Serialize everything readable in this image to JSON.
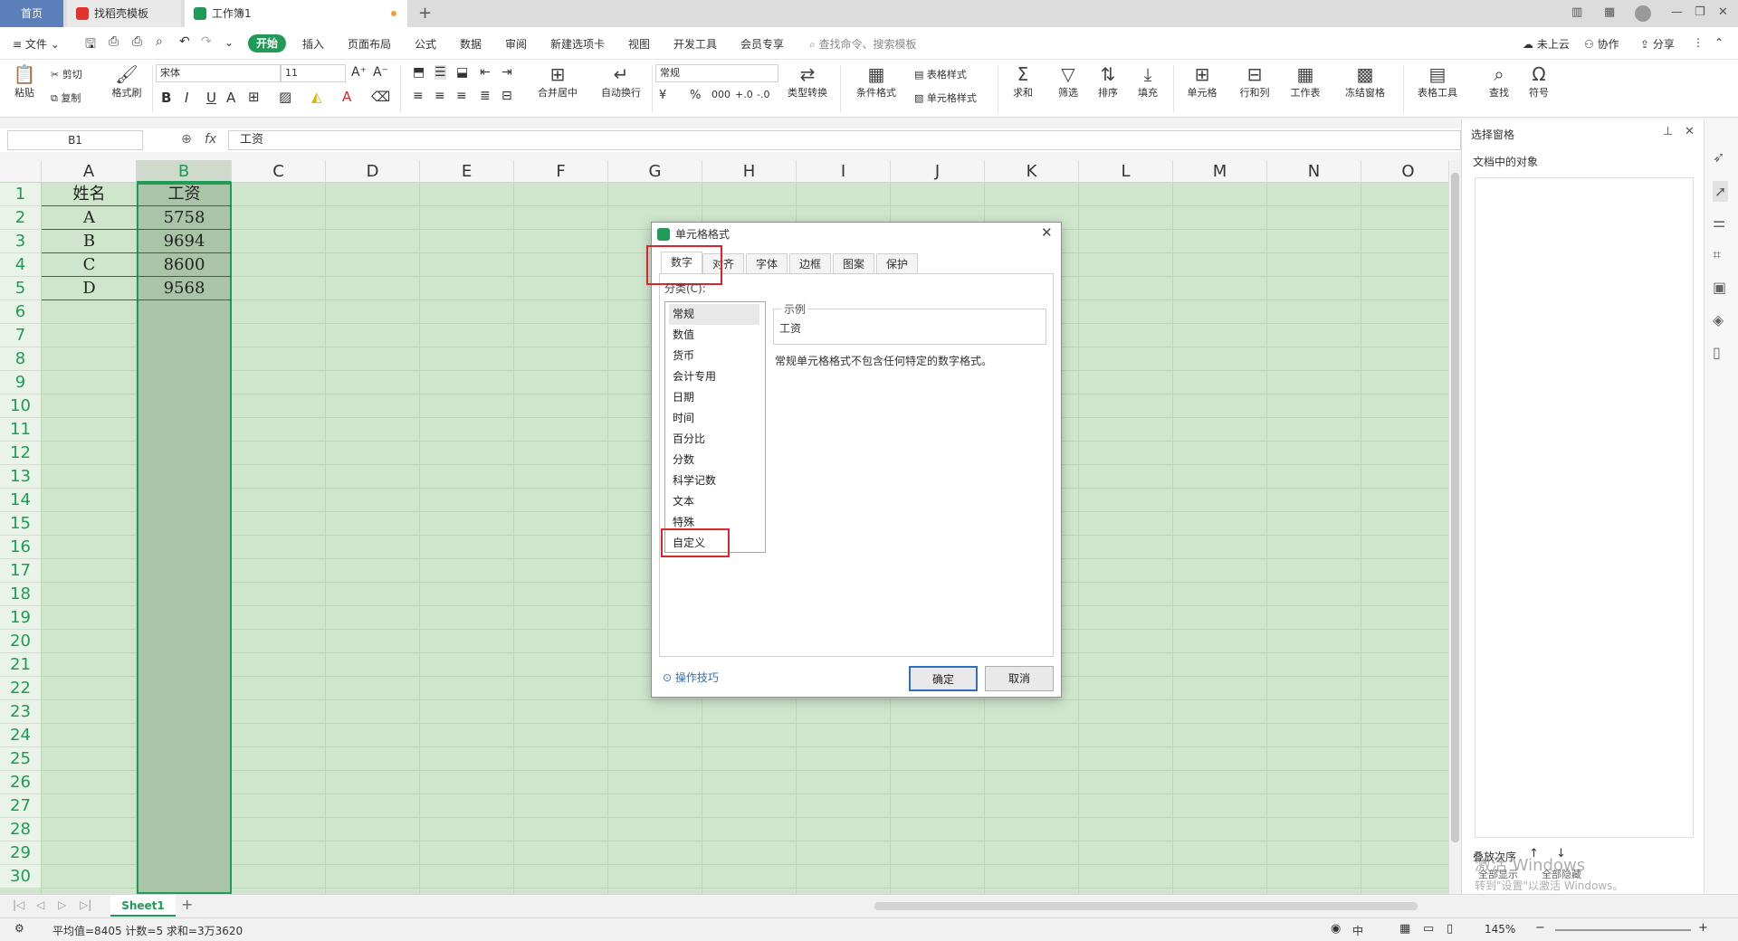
{
  "tabs": [
    {
      "label": "首页"
    },
    {
      "label": "找稻壳模板"
    },
    {
      "label": "工作簿1"
    }
  ],
  "menu": {
    "file": "文件",
    "items": [
      "开始",
      "插入",
      "页面布局",
      "公式",
      "数据",
      "审阅",
      "新建选项卡",
      "视图",
      "开发工具",
      "会员专享"
    ],
    "search_placeholder": "查找命令、搜索模板",
    "right": [
      "未上云",
      "协作",
      "分享"
    ]
  },
  "ribbon": {
    "paste": "粘贴",
    "cut": "剪切",
    "copy": "复制",
    "format_painter": "格式刷",
    "font_name": "宋体",
    "font_size": "11",
    "merge": "合并居中",
    "wrap": "自动换行",
    "number_format": "常规",
    "type_convert": "类型转换",
    "cond_format": "条件格式",
    "table_style": "表格样式",
    "cell_style": "单元格样式",
    "sum": "求和",
    "filter": "筛选",
    "sort": "排序",
    "fill": "填充",
    "cell": "单元格",
    "rowcol": "行和列",
    "worksheet": "工作表",
    "freeze": "冻结窗格",
    "table_tools": "表格工具",
    "find": "查找",
    "symbol": "符号"
  },
  "formula_bar": {
    "name_box": "B1",
    "fx": "fx",
    "content": "工资"
  },
  "grid": {
    "columns": [
      "A",
      "B",
      "C",
      "D",
      "E",
      "F",
      "G",
      "H",
      "I",
      "J",
      "K",
      "L",
      "M",
      "N",
      "O"
    ],
    "rows": [
      "1",
      "2",
      "3",
      "4",
      "5",
      "6",
      "7",
      "8",
      "9",
      "10",
      "11",
      "12",
      "13",
      "14",
      "15",
      "16",
      "17",
      "18",
      "19",
      "20",
      "21",
      "22",
      "23",
      "24",
      "25",
      "26",
      "27",
      "28",
      "29",
      "30"
    ],
    "data": [
      [
        "姓名",
        "工资"
      ],
      [
        "A",
        "5758"
      ],
      [
        "B",
        "9694"
      ],
      [
        "C",
        "8600"
      ],
      [
        "D",
        "9568"
      ]
    ]
  },
  "dialog": {
    "title": "单元格格式",
    "tabs": [
      "数字",
      "对齐",
      "字体",
      "边框",
      "图案",
      "保护"
    ],
    "category_label": "分类(C):",
    "categories": [
      "常规",
      "数值",
      "货币",
      "会计专用",
      "日期",
      "时间",
      "百分比",
      "分数",
      "科学记数",
      "文本",
      "特殊",
      "自定义"
    ],
    "sample_label": "示例",
    "sample_value": "工资",
    "description": "常规单元格格式不包含任何特定的数字格式。",
    "tips": "操作技巧",
    "ok": "确定",
    "cancel": "取消"
  },
  "right_pane": {
    "title": "选择窗格",
    "subtitle": "文档中的对象",
    "order_label": "叠放次序",
    "show_all": "全部显示",
    "hide_all": "全部隐藏",
    "watermark1": "激活 Windows",
    "watermark2": "转到\"设置\"以激活 Windows。"
  },
  "sheet_tab": "Sheet1",
  "status": {
    "stats": "平均值=8405  计数=5  求和=3万3620",
    "ime": "中",
    "zoom": "145%"
  },
  "colors": {
    "accent": "#1f9b57",
    "highlight": "#d9262b",
    "grid_bg": "#cfe6cc"
  }
}
